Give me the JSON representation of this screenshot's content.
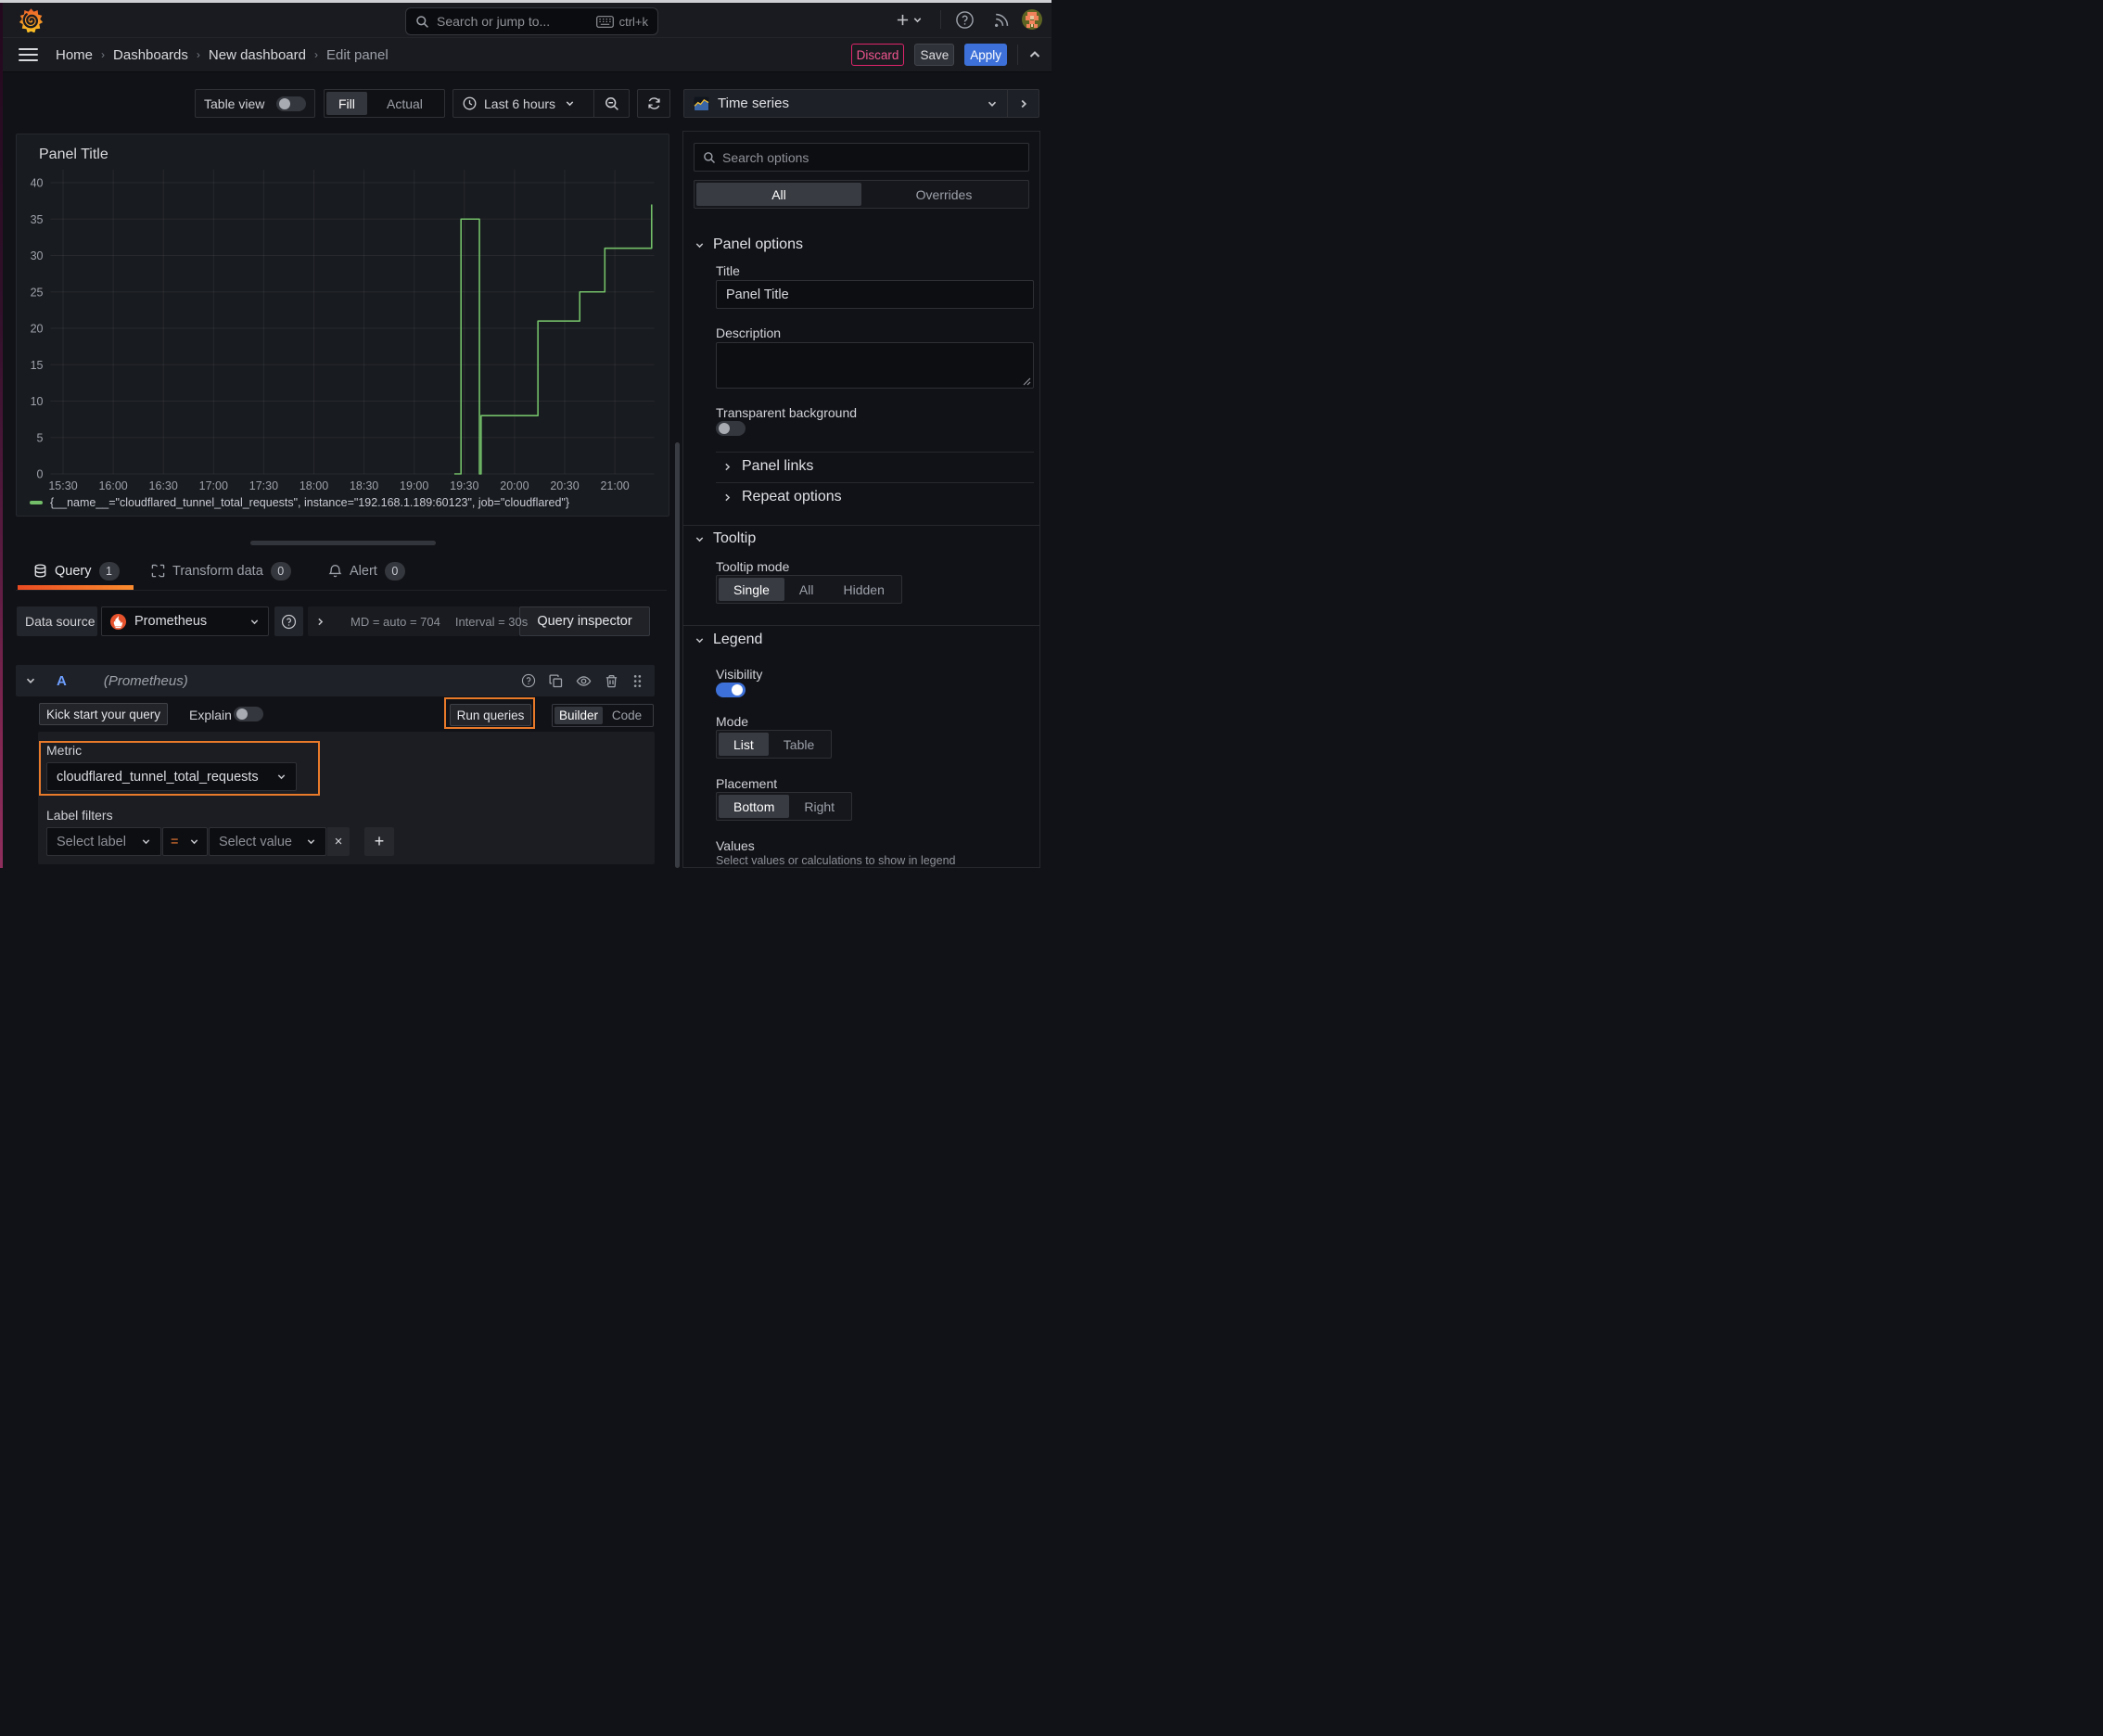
{
  "colors": {
    "series_green": "#73BF69",
    "annotation_orange": "#e87a2a",
    "apply_blue": "#3d71d9",
    "discard_pink": "#e0246c",
    "tab_underline": "#f05a28"
  },
  "nav": {
    "search_placeholder": "Search or jump to...",
    "search_shortcut": "ctrl+k"
  },
  "breadcrumb": {
    "items": [
      "Home",
      "Dashboards",
      "New dashboard",
      "Edit panel"
    ],
    "discard_label": "Discard",
    "save_label": "Save",
    "apply_label": "Apply"
  },
  "toolbar": {
    "table_view_label": "Table view",
    "fill_label": "Fill",
    "actual_label": "Actual",
    "time_range": "Last 6 hours"
  },
  "visualization": {
    "type_label": "Time series"
  },
  "panel": {
    "title": "Panel Title"
  },
  "chart_data": {
    "type": "line",
    "title": "Panel Title",
    "step": "after",
    "grid": true,
    "legend_position": "bottom",
    "ylim": [
      0,
      40
    ],
    "y_ticks": [
      0,
      5,
      10,
      15,
      20,
      25,
      30,
      35,
      40
    ],
    "x_ticks": [
      "15:30",
      "16:00",
      "16:30",
      "17:00",
      "17:30",
      "18:00",
      "18:30",
      "19:00",
      "19:30",
      "20:00",
      "20:30",
      "21:00"
    ],
    "x_range": [
      "15:30",
      "21:22"
    ],
    "series": [
      {
        "name": "{__name__=\"cloudflared_tunnel_total_requests\", instance=\"192.168.1.189:60123\", job=\"cloudflared\"}",
        "color": "#73BF69",
        "points": [
          [
            "19:24",
            0
          ],
          [
            "19:28",
            35
          ],
          [
            "19:39",
            0
          ],
          [
            "19:40",
            8
          ],
          [
            "20:14",
            21
          ],
          [
            "20:39",
            25
          ],
          [
            "20:54",
            31
          ],
          [
            "21:22",
            37
          ]
        ]
      }
    ]
  },
  "tabs": {
    "query": {
      "label": "Query",
      "count": "1"
    },
    "transform": {
      "label": "Transform data",
      "count": "0"
    },
    "alert": {
      "label": "Alert",
      "count": "0"
    }
  },
  "query": {
    "datasource_label": "Data source",
    "datasource_value": "Prometheus",
    "stats_md": "MD = auto = 704",
    "stats_interval": "Interval = 30s",
    "query_inspector_label": "Query inspector",
    "row_ref": "A",
    "row_datasource": "(Prometheus)",
    "kick_start_label": "Kick start your query",
    "explain_label": "Explain",
    "run_queries_label": "Run queries",
    "builder_label": "Builder",
    "code_label": "Code",
    "metric_label": "Metric",
    "metric_value": "cloudflared_tunnel_total_requests",
    "label_filters_label": "Label filters",
    "select_label_placeholder": "Select label",
    "operator_value": "=",
    "select_value_placeholder": "Select value",
    "remove_label": "×",
    "add_label": "+"
  },
  "options": {
    "search_placeholder": "Search options",
    "filter_all": "All",
    "filter_overrides": "Overrides",
    "panel_options_title": "Panel options",
    "title_label": "Title",
    "title_value": "Panel Title",
    "description_label": "Description",
    "transparent_label": "Transparent background",
    "panel_links_label": "Panel links",
    "repeat_options_label": "Repeat options",
    "tooltip_title": "Tooltip",
    "tooltip_mode_label": "Tooltip mode",
    "tooltip_modes": [
      "Single",
      "All",
      "Hidden"
    ],
    "tooltip_mode_selected": "Single",
    "legend_title": "Legend",
    "visibility_label": "Visibility",
    "mode_label": "Mode",
    "legend_modes": [
      "List",
      "Table"
    ],
    "legend_mode_selected": "List",
    "placement_label": "Placement",
    "placements": [
      "Bottom",
      "Right"
    ],
    "placement_selected": "Bottom",
    "values_label": "Values",
    "values_hint": "Select values or calculations to show in legend"
  }
}
